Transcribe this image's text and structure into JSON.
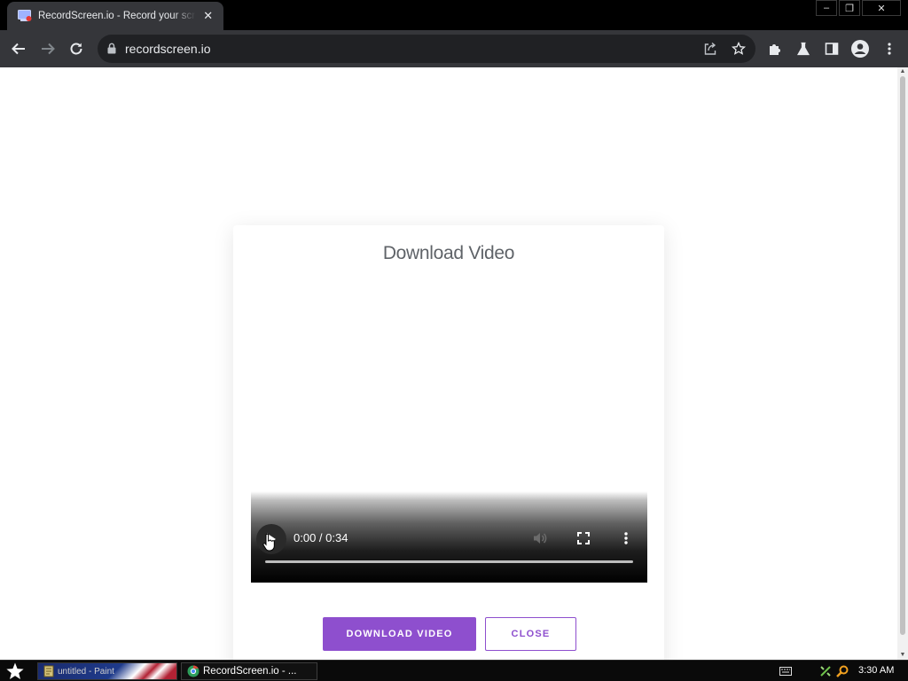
{
  "browser": {
    "tab_title": "RecordScreen.io - Record your screen",
    "tab_close_icon": "close-icon",
    "url": "recordscreen.io",
    "window_controls": {
      "minimize": "–",
      "restore": "❐",
      "close": "✕"
    }
  },
  "modal": {
    "title": "Download Video",
    "video": {
      "time_display": "0:00 / 0:34",
      "progress_fraction": 0
    },
    "download_button_label": "DOWNLOAD VIDEO",
    "close_button_label": "CLOSE"
  },
  "taskbar": {
    "item1_label": "untitled - Paint",
    "item2_label": "RecordScreen.io - ...",
    "clock": "3:30 AM"
  },
  "colors": {
    "accent": "#8e4fce",
    "chrome_dark": "#35363a"
  }
}
